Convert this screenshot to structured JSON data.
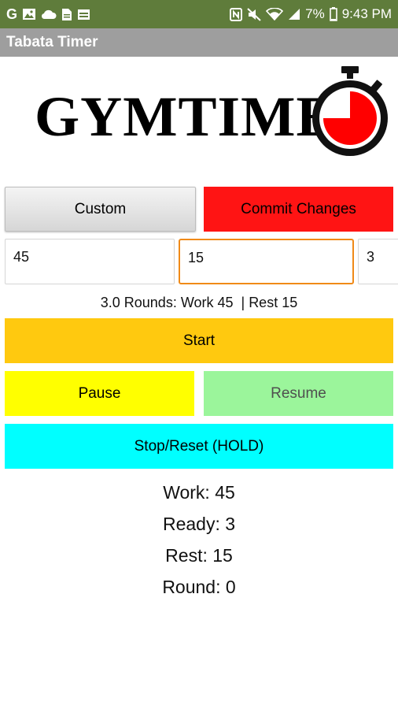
{
  "status_bar": {
    "time": "9:43 PM",
    "battery": "7%",
    "left_icons": [
      "google-icon",
      "image-icon",
      "cloud-icon",
      "document-icon",
      "calendar-icon"
    ],
    "right_icons": [
      "nfc-icon",
      "mute-icon",
      "wifi-icon",
      "signal-icon",
      "battery-icon"
    ]
  },
  "app": {
    "title": "Tabata Timer"
  },
  "logo": {
    "text": "GYMTIME",
    "icon": "stopwatch-icon",
    "accent_color": "#ff0000"
  },
  "buttons": {
    "custom": "Custom",
    "commit": "Commit Changes",
    "start": "Start",
    "pause": "Pause",
    "resume": "Resume",
    "stop": "Stop/Reset (HOLD)"
  },
  "inputs": {
    "work": "45",
    "rest": "15",
    "rounds": "3"
  },
  "summary": "3.0 Rounds: Work 45  | Rest 15",
  "stats": {
    "work": "Work: 45",
    "ready": "Ready: 3",
    "rest": "Rest: 15",
    "round": "Round: 0"
  },
  "colors": {
    "status_bar": "#5f7c3b",
    "title_bar": "#9e9e9e",
    "commit": "#ff1414",
    "start": "#ffc90f",
    "pause": "#ffff00",
    "resume": "#9bf59b",
    "stop": "#00ffff",
    "focus_border": "#f08a18"
  }
}
